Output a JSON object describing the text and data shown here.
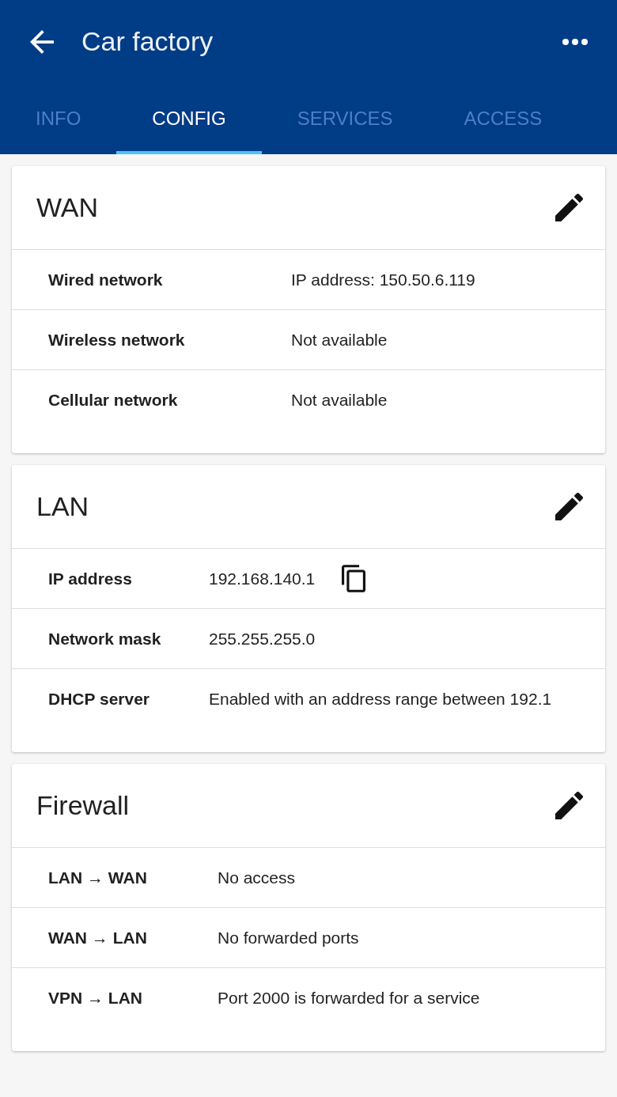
{
  "app_bar": {
    "title": "Car factory"
  },
  "tabs": [
    {
      "label": "INFO",
      "selected": false
    },
    {
      "label": "CONFIG",
      "selected": true
    },
    {
      "label": "SERVICES",
      "selected": false
    },
    {
      "label": "ACCESS",
      "selected": false
    }
  ],
  "cards": [
    {
      "title": "WAN",
      "rows": [
        {
          "label": "Wired network",
          "value": "IP address: 150.50.6.119",
          "copyable": false
        },
        {
          "label": "Wireless network",
          "value": "Not available",
          "copyable": false
        },
        {
          "label": "Cellular network",
          "value": "Not available",
          "copyable": false
        }
      ]
    },
    {
      "title": "LAN",
      "rows": [
        {
          "label": "IP address",
          "value": "192.168.140.1",
          "copyable": true
        },
        {
          "label": "Network mask",
          "value": "255.255.255.0",
          "copyable": false
        },
        {
          "label": "DHCP server",
          "value": "Enabled with an address range between 192.1",
          "copyable": false
        }
      ]
    },
    {
      "title": "Firewall",
      "rows": [
        {
          "label": "LAN → WAN",
          "value": "No access",
          "copyable": false
        },
        {
          "label": "WAN → LAN",
          "value": "No forwarded ports",
          "copyable": false
        },
        {
          "label": "VPN → LAN",
          "value": "Port 2000 is forwarded for a service",
          "copyable": false
        }
      ]
    }
  ]
}
